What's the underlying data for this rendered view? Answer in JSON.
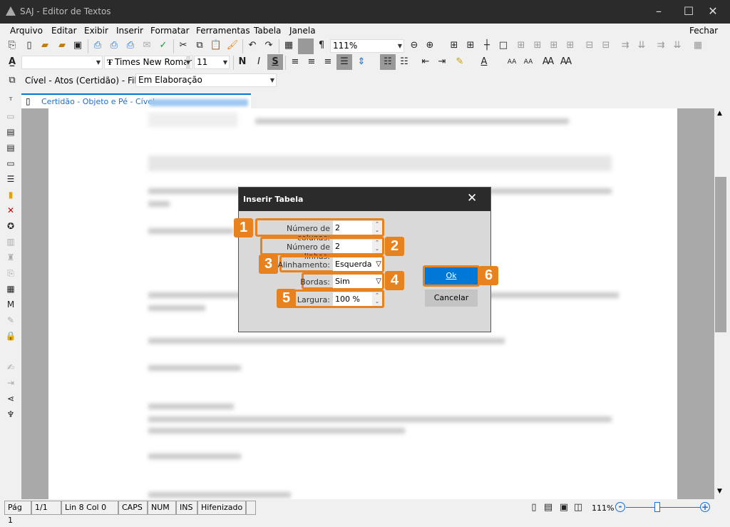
{
  "window": {
    "title": "SAJ - Editor de Textos",
    "close_doc": "Fechar"
  },
  "menu": [
    "Arquivo",
    "Editar",
    "Exibir",
    "Inserir",
    "Formatar",
    "Ferramentas",
    "Tabela",
    "Janela"
  ],
  "toolbar": {
    "zoom": "111%",
    "style": "",
    "font": "Times New Roman",
    "font_size": "11"
  },
  "queue": {
    "label": "Cível - Atos (Certidão) - Fila:",
    "value": "Em Elaboração"
  },
  "tab": {
    "label": "Certidão - Objeto e Pé - Cível"
  },
  "dialog": {
    "title": "Inserir Tabela",
    "columns_label": "Número de colunas:",
    "columns_value": "2",
    "rows_label": "Número de linhas:",
    "rows_value": "2",
    "align_label": "Alinhamento:",
    "align_value": "Esquerda",
    "borders_label": "Bordas:",
    "borders_value": "Sim",
    "width_label": "Largura:",
    "width_value": "100 %",
    "ok": "Ok",
    "cancel": "Cancelar",
    "badges": [
      "1",
      "2",
      "3",
      "4",
      "5",
      "6"
    ],
    "highlight_color": "#e8821e",
    "ok_color": "#0078d7"
  },
  "status": {
    "page": "Pág 1",
    "pages": "1/1",
    "pos": "Lin 8  Col 0",
    "caps": "CAPS",
    "num": "NUM",
    "ins": "INS",
    "hyph": "Hifenizado",
    "zoom": "111%",
    "zoom_level_percent": 111
  }
}
